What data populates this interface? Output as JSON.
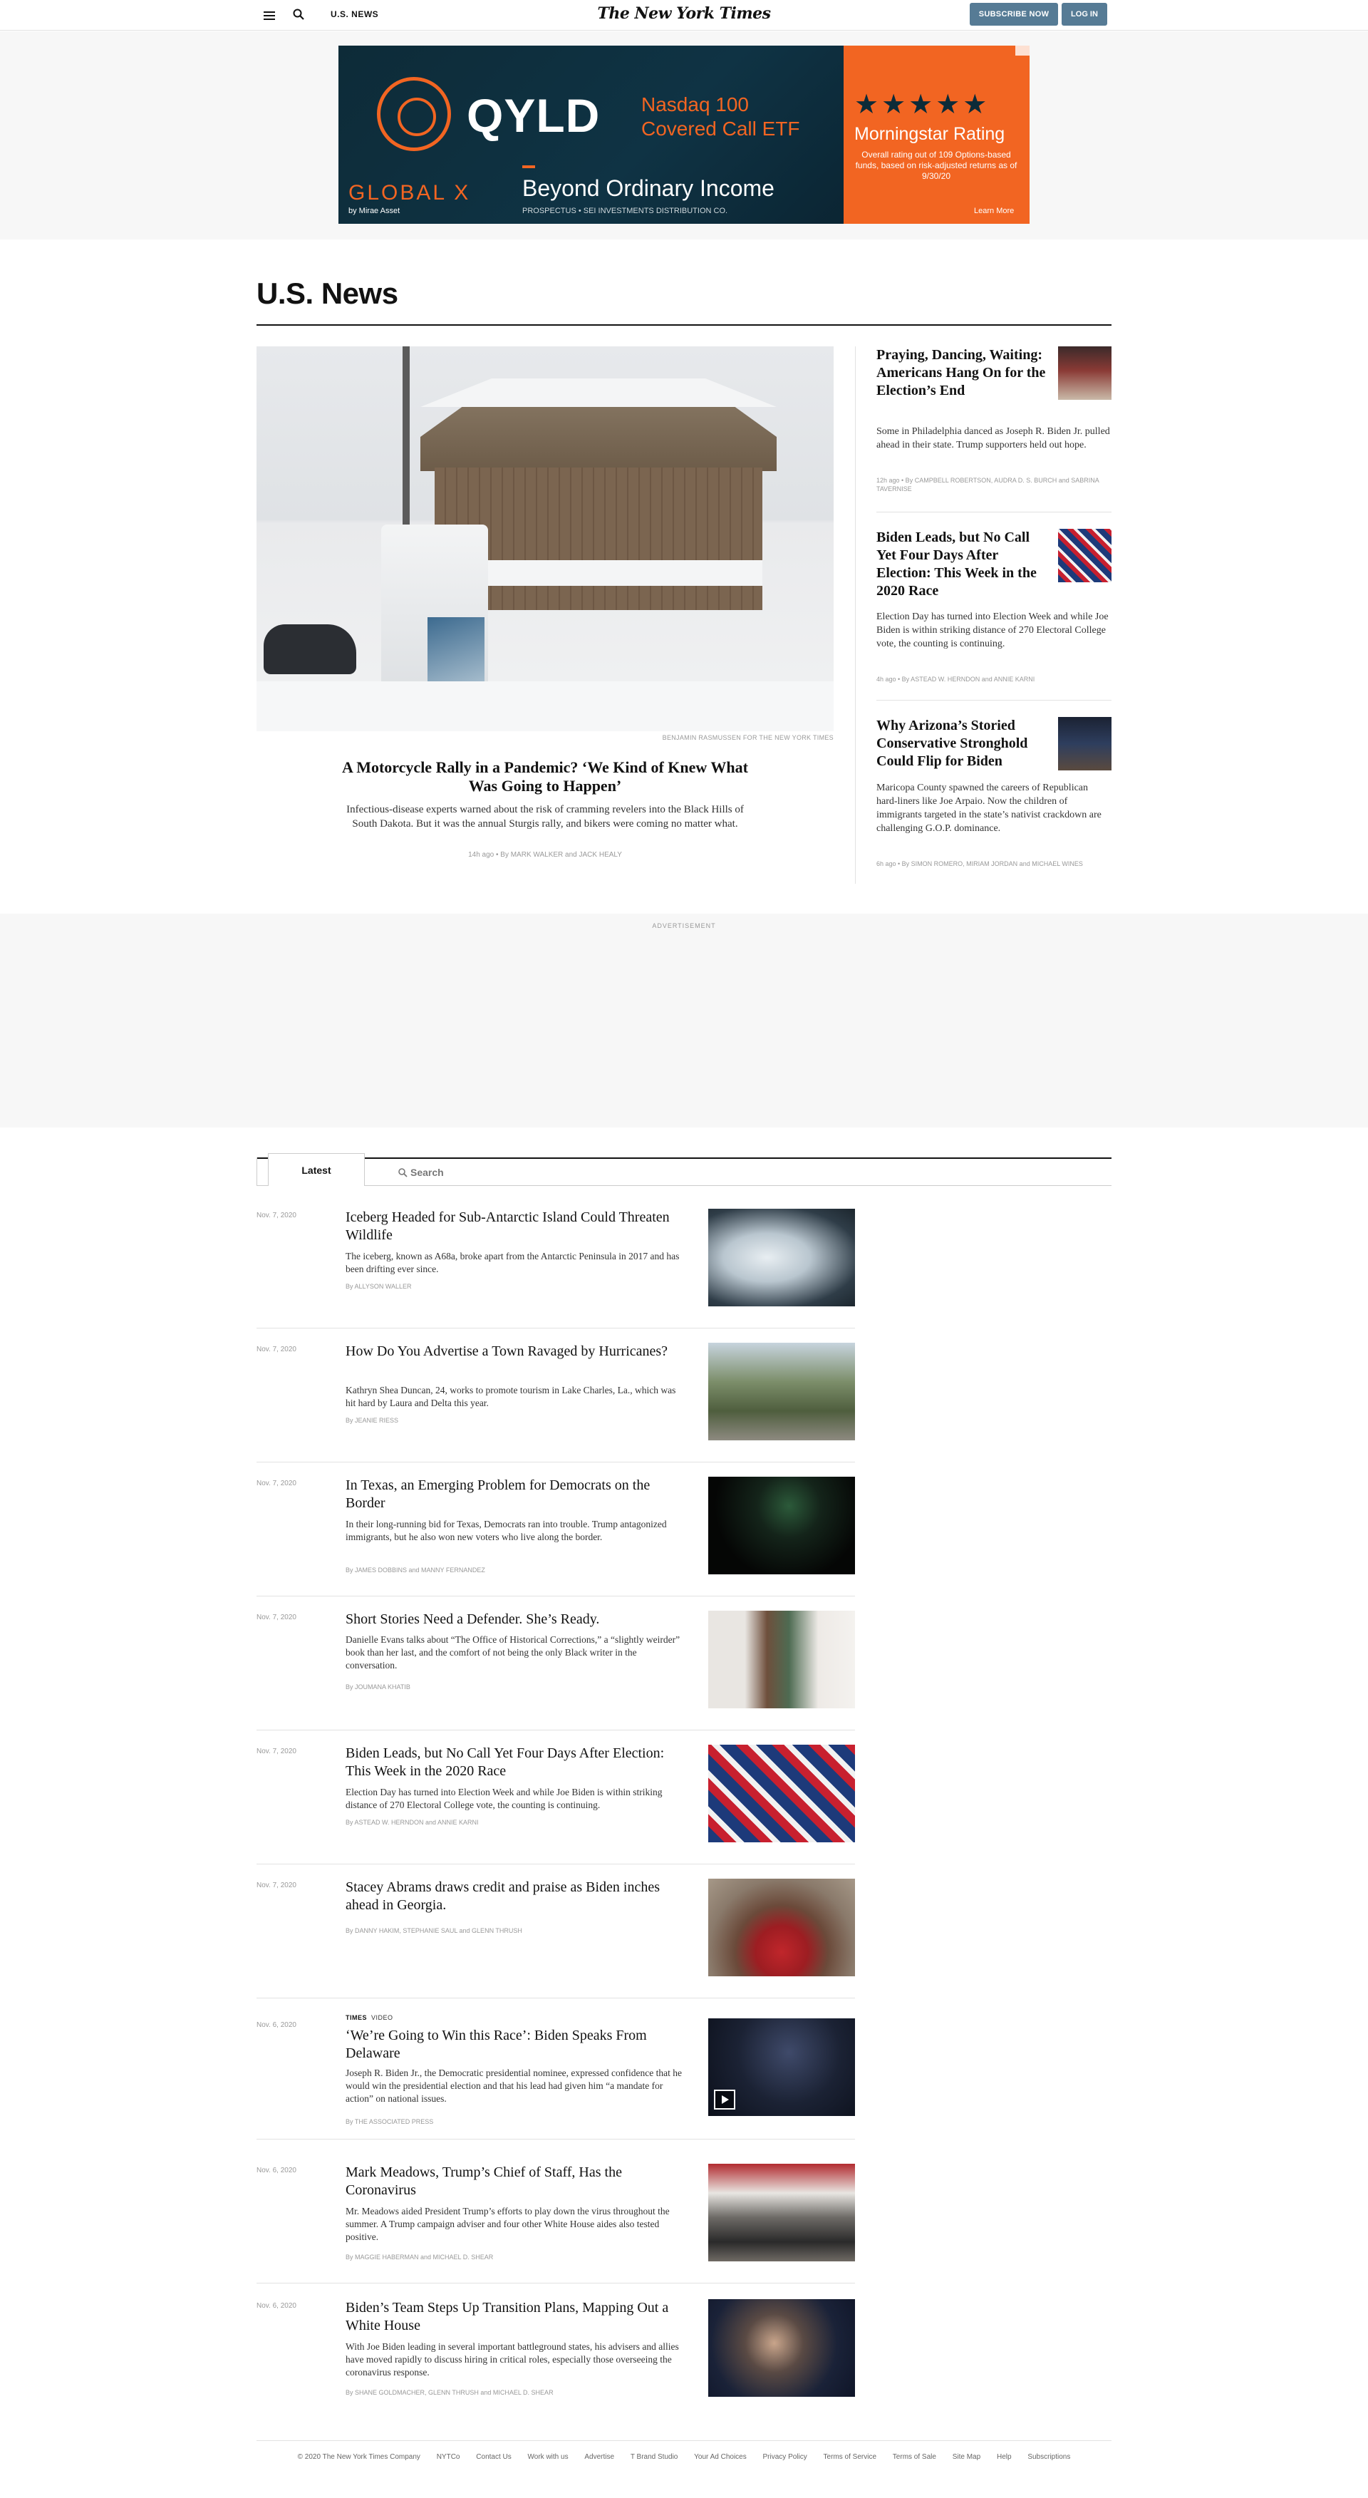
{
  "masthead": {
    "section": "U.S. NEWS",
    "logo": "The New York Times",
    "subscribe": "SUBSCRIBE NOW",
    "login": "LOG IN"
  },
  "top_ad": {
    "qyld": "QYLD",
    "nasdaq_line1": "Nasdaq 100",
    "nasdaq_line2": "Covered Call ETF",
    "brand": "GLOBAL X",
    "brand_sub": "by Mirae Asset",
    "tagline": "Beyond Ordinary Income",
    "prospectus": "PROSPECTUS • SEI INVESTMENTS DISTRIBUTION CO.",
    "stars": "★★★★★",
    "rating": "Morningstar Rating",
    "rating_note": "Overall rating out of 109 Options-based funds, based on risk-adjusted returns as of 9/30/20",
    "learn": "Learn More"
  },
  "section_title": "U.S. News",
  "lead": {
    "credit": "BENJAMIN RASMUSSEN FOR THE NEW YORK TIMES",
    "headline": "A Motorcycle Rally in a Pandemic? ‘We Kind of Knew What Was Going to Happen’",
    "summary": "Infectious-disease experts warned about the risk of cramming revelers into the Black Hills of South Dakota. But it was the annual Sturgis rally, and bikers were coming no matter what.",
    "meta": "14h ago  •  By MARK WALKER and JACK HEALY"
  },
  "side_stories": [
    {
      "headline": "Praying, Dancing, Waiting: Americans Hang On for the Election’s End",
      "summary": "Some in Philadelphia danced as Joseph R. Biden Jr. pulled ahead in their state. Trump supporters held out hope.",
      "meta": "12h ago  •  By CAMPBELL ROBERTSON, AUDRA D. S. BURCH and SABRINA TAVERNISE"
    },
    {
      "headline": "Biden Leads, but No Call Yet Four Days After Election: This Week in the 2020 Race",
      "summary": "Election Day has turned into Election Week and while Joe Biden is within striking distance of 270 Electoral College vote, the counting is continuing.",
      "meta": "4h ago  •  By ASTEAD W. HERNDON and ANNIE KARNI"
    },
    {
      "headline": "Why Arizona’s Storied Conservative Stronghold Could Flip for Biden",
      "summary": "Maricopa County spawned the careers of Republican hard-liners like Joe Arpaio. Now the children of immigrants targeted in the state’s nativist crackdown are challenging G.O.P. dominance.",
      "meta": "6h ago  •  By SIMON ROMERO, MIRIAM JORDAN and MICHAEL WINES"
    }
  ],
  "mid_ad_label": "ADVERTISEMENT",
  "tabs": {
    "latest": "Latest",
    "search_placeholder": "Search"
  },
  "latest": [
    {
      "date": "Nov. 7, 2020",
      "headline": "Iceberg Headed for Sub-Antarctic Island Could Threaten Wildlife",
      "summary": "The iceberg, known as A68a, broke apart from the Antarctic Peninsula in 2017 and has been drifting ever since.",
      "byline": "By ALLYSON WALLER"
    },
    {
      "date": "Nov. 7, 2020",
      "headline": "How Do You Advertise a Town Ravaged by Hurricanes?",
      "summary": "Kathryn Shea Duncan, 24, works to promote tourism in Lake Charles, La., which was hit hard by Laura and Delta this year.",
      "byline": "By JEANIE RIESS"
    },
    {
      "date": "Nov. 7, 2020",
      "headline": "In Texas, an Emerging Problem for Democrats on the Border",
      "summary": "In their long-running bid for Texas, Democrats ran into trouble. Trump antagonized immigrants, but he also won new voters who live along the border.",
      "byline": "By JAMES DOBBINS and MANNY FERNANDEZ"
    },
    {
      "date": "Nov. 7, 2020",
      "headline": "Short Stories Need a Defender. She’s Ready.",
      "summary": "Danielle Evans talks about “The Office of Historical Corrections,” a “slightly weirder” book than her last, and the comfort of not being the only Black writer in the conversation.",
      "byline": "By JOUMANA KHATIB"
    },
    {
      "date": "Nov. 7, 2020",
      "headline": "Biden Leads, but No Call Yet Four Days After Election: This Week in the 2020 Race",
      "summary": "Election Day has turned into Election Week and while Joe Biden is within striking distance of 270 Electoral College vote, the counting is continuing.",
      "byline": "By ASTEAD W. HERNDON and ANNIE KARNI"
    },
    {
      "date": "Nov. 7, 2020",
      "headline": "Stacey Abrams draws credit and praise as Biden inches ahead in Georgia.",
      "summary": "",
      "byline": "By DANNY HAKIM, STEPHANIE SAUL and GLENN THRUSH"
    },
    {
      "date": "Nov. 6, 2020",
      "kicker": "TIMES",
      "kicker_sub": "VIDEO",
      "headline": "‘We’re Going to Win this Race’: Biden Speaks From Delaware",
      "summary": "Joseph R. Biden Jr., the Democratic presidential nominee, expressed confidence that he would win the presidential election and that his lead had given him “a mandate for action” on national issues.",
      "byline": "By THE ASSOCIATED PRESS"
    },
    {
      "date": "Nov. 6, 2020",
      "headline": "Mark Meadows, Trump’s Chief of Staff, Has the Coronavirus",
      "summary": "Mr. Meadows aided President Trump’s efforts to play down the virus throughout the summer. A Trump campaign adviser and four other White House aides also tested positive.",
      "byline": "By MAGGIE HABERMAN and MICHAEL D. SHEAR"
    },
    {
      "date": "Nov. 6, 2020",
      "headline": "Biden’s Team Steps Up Transition Plans, Mapping Out a White House",
      "summary": "With Joe Biden leading in several important battleground states, his advisers and allies have moved rapidly to discuss hiring in critical roles, especially those overseeing the coronavirus response.",
      "byline": "By SHANE GOLDMACHER, GLENN THRUSH and MICHAEL D. SHEAR"
    }
  ],
  "footer": {
    "copyright": "© 2020 The New York Times Company",
    "links": [
      "NYTCo",
      "Contact Us",
      "Work with us",
      "Advertise",
      "T Brand Studio",
      "Your Ad Choices",
      "Privacy Policy",
      "Terms of Service",
      "Terms of Sale",
      "Site Map",
      "Help",
      "Subscriptions"
    ]
  }
}
